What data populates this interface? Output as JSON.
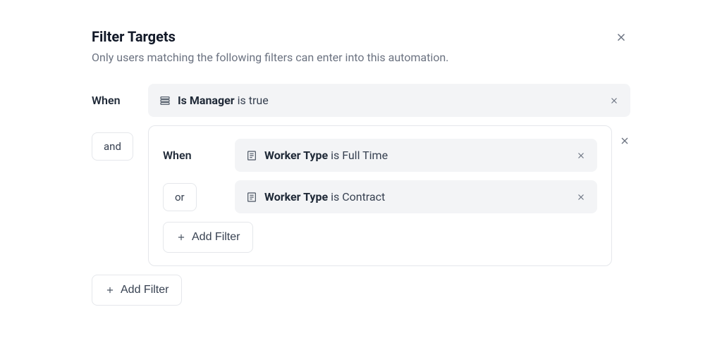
{
  "header": {
    "title": "Filter Targets",
    "subtitle": "Only users matching the following filters can enter into this automation."
  },
  "labels": {
    "when": "When",
    "and": "and",
    "or": "or",
    "add_filter": "Add Filter"
  },
  "filters": {
    "top": {
      "field": "Is Manager",
      "op": "is",
      "value": "true"
    },
    "group": {
      "rows": [
        {
          "field": "Worker Type",
          "op": "is",
          "value": "Full Time"
        },
        {
          "field": "Worker Type",
          "op": "is",
          "value": "Contract"
        }
      ]
    }
  }
}
